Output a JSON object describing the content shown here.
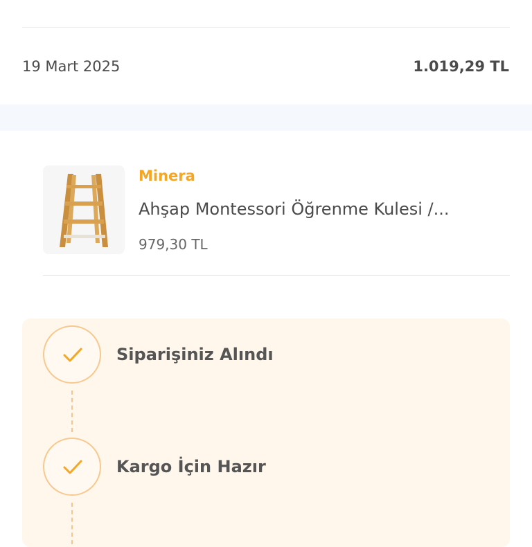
{
  "order": {
    "date": "19 Mart 2025",
    "total": "1.019,29 TL"
  },
  "item": {
    "brand": "Minera",
    "name": "Ahşap Montessori Öğrenme Kulesi /...",
    "price": "979,30 TL",
    "image_icon": "wooden-learning-tower"
  },
  "timeline": {
    "steps": [
      {
        "label": "Siparişiniz Alındı",
        "status": "done",
        "icon": "check-icon"
      },
      {
        "label": "Kargo İçin Hazır",
        "status": "done",
        "icon": "check-icon"
      }
    ]
  },
  "colors": {
    "accent": "#f5a623",
    "timeline_bg": "#fff6ec",
    "band": "#f5f8fc"
  }
}
